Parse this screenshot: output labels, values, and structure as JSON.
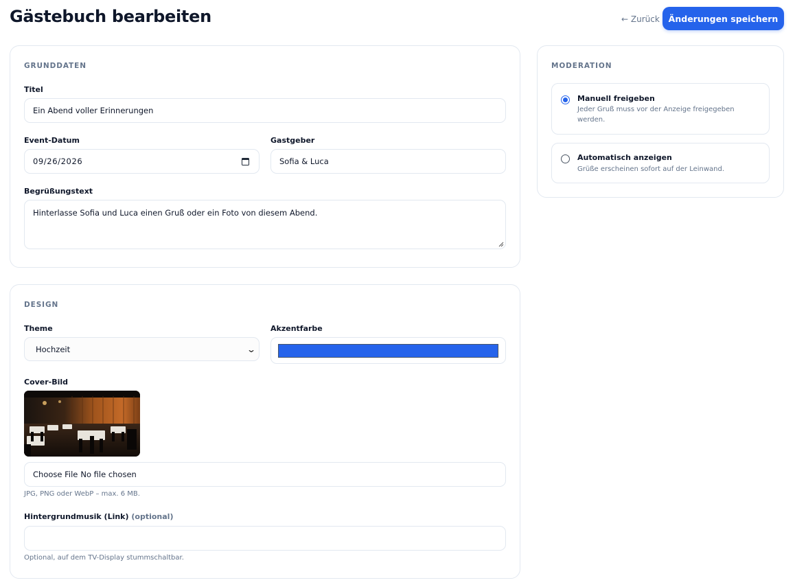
{
  "header": {
    "title": "Gästebuch bearbeiten",
    "back_label": "← Zurück",
    "save_label": "Änderungen speichern"
  },
  "basics": {
    "section_title": "GRUNDDATEN",
    "title_label": "Titel",
    "title_value": "Ein Abend voller Erinnerungen",
    "date_label": "Event-Datum",
    "date_value": "09/26/2026",
    "host_label": "Gastgeber",
    "host_value": "Sofia & Luca",
    "welcome_label": "Begrüßungstext",
    "welcome_value": "Hinterlasse Sofia und Luca einen Gruß oder ein Foto von diesem Abend."
  },
  "design": {
    "section_title": "DESIGN",
    "theme_label": "Theme",
    "theme_value": "Hochzeit",
    "accent_label": "Akzentfarbe",
    "accent_color": "#2563eb",
    "cover_label": "Cover-Bild",
    "file_button": "Choose File",
    "file_status": "No file chosen",
    "file_hint": "JPG, PNG oder WebP – max. 6 MB.",
    "music_label": "Hintergrundmusik (Link)",
    "music_optional": "(optional)",
    "music_value": "",
    "music_hint": "Optional, auf dem TV-Display stummschaltbar."
  },
  "moderation": {
    "section_title": "MODERATION",
    "options": [
      {
        "title": "Manuell freigeben",
        "description": "Jeder Gruß muss vor der Anzeige freigegeben werden.",
        "checked": true
      },
      {
        "title": "Automatisch anzeigen",
        "description": "Grüße erscheinen sofort auf der Leinwand.",
        "checked": false
      }
    ]
  },
  "colors": {
    "primary": "#2563eb",
    "text": "#0f172a",
    "muted": "#64748b",
    "border": "#e2e8f0"
  }
}
